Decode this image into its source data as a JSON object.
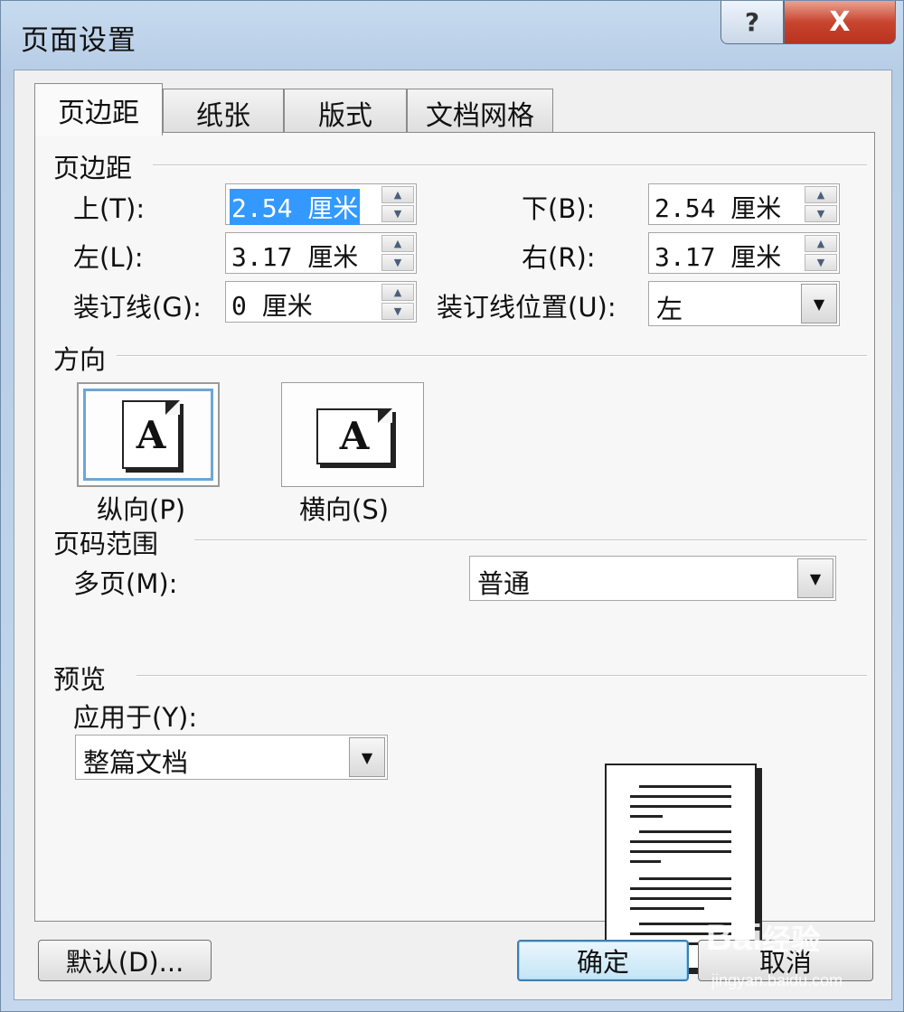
{
  "window": {
    "title": "页面设置",
    "help_label": "?",
    "close_label": "X"
  },
  "tabs": [
    {
      "label": "页边距",
      "active": true
    },
    {
      "label": "纸张",
      "active": false
    },
    {
      "label": "版式",
      "active": false
    },
    {
      "label": "文档网格",
      "active": false
    }
  ],
  "margins": {
    "group_title": "页边距",
    "top": {
      "label": "上(T):",
      "value": "2.54 厘米"
    },
    "bottom": {
      "label": "下(B):",
      "value": "2.54 厘米"
    },
    "left": {
      "label": "左(L):",
      "value": "3.17 厘米"
    },
    "right": {
      "label": "右(R):",
      "value": "3.17 厘米"
    },
    "gutter": {
      "label": "装订线(G):",
      "value": "0 厘米"
    },
    "gutter_position": {
      "label": "装订线位置(U):",
      "value": "左"
    }
  },
  "orientation": {
    "group_title": "方向",
    "portrait": {
      "label": "纵向(P)",
      "glyph": "A",
      "selected": true
    },
    "landscape": {
      "label": "横向(S)",
      "glyph": "A",
      "selected": false
    }
  },
  "pages": {
    "group_title": "页码范围",
    "multiple_label": "多页(M):",
    "multiple_value": "普通"
  },
  "preview": {
    "group_title": "预览",
    "apply_label": "应用于(Y):",
    "apply_value": "整篇文档"
  },
  "buttons": {
    "default": "默认(D)...",
    "ok": "确定",
    "cancel": "取消"
  },
  "watermark": {
    "brand": "Bai",
    "brand_suffix": "经验",
    "url": "jingyan.baidu.com"
  }
}
